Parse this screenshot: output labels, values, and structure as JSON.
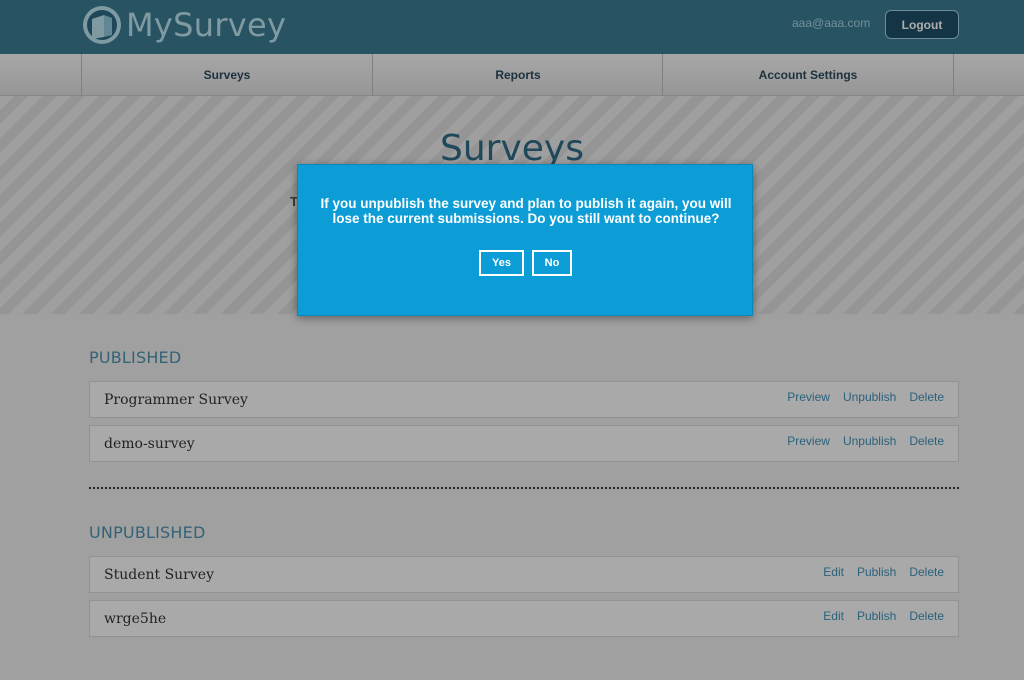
{
  "header": {
    "app_name": "MySurvey",
    "user_email": "aaa@aaa.com",
    "logout_label": "Logout"
  },
  "nav": {
    "items": [
      {
        "label": "Surveys"
      },
      {
        "label": "Reports"
      },
      {
        "label": "Account Settings"
      }
    ]
  },
  "hero": {
    "title": "Surveys",
    "partial_text": "T"
  },
  "published": {
    "heading": "PUBLISHED",
    "rows": [
      {
        "name": "Programmer Survey",
        "actions": [
          "Preview",
          "Unpublish",
          "Delete"
        ]
      },
      {
        "name": "demo-survey",
        "actions": [
          "Preview",
          "Unpublish",
          "Delete"
        ]
      }
    ]
  },
  "unpublished": {
    "heading": "UNPUBLISHED",
    "rows": [
      {
        "name": "Student Survey",
        "actions": [
          "Edit",
          "Publish",
          "Delete"
        ]
      },
      {
        "name": "wrge5he",
        "actions": [
          "Edit",
          "Publish",
          "Delete"
        ]
      }
    ]
  },
  "modal": {
    "message": "If you unpublish the survey and plan to publish it again, you will lose the current submissions. Do you still want to continue?",
    "yes_label": "Yes",
    "no_label": "No"
  },
  "colors": {
    "header_bg": "#3a7b93",
    "modal_bg": "#0c9dd6",
    "link": "#3f8fb5",
    "section_heading": "#4f91ad"
  }
}
